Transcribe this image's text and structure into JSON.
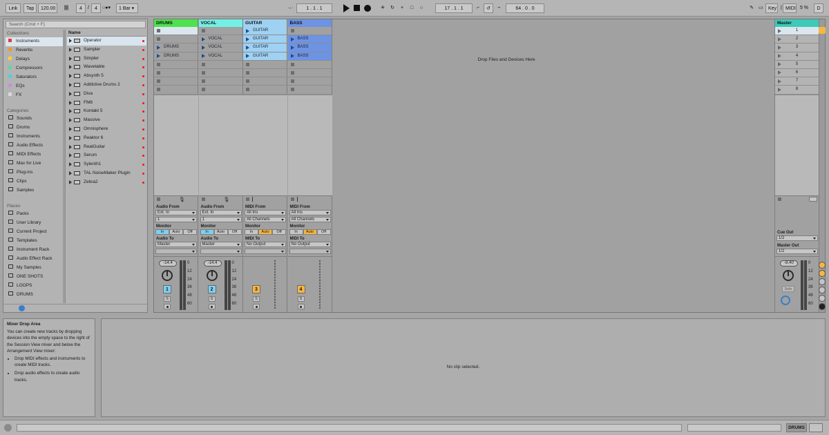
{
  "transport": {
    "link": "Link",
    "tap": "Tap",
    "tempo": "120.00",
    "signature_num": "4",
    "signature_den": "4",
    "quantize": "1 Bar",
    "position": [
      "1",
      "1",
      "1"
    ],
    "loop_start": [
      "17",
      "1",
      "1"
    ],
    "loop_length": [
      "64",
      "0",
      "0"
    ],
    "key": "Key",
    "midi": "MIDI",
    "cpu": "5 %",
    "disk": "D"
  },
  "browser": {
    "search_placeholder": "Search (Cmd + F)",
    "collections_header": "Collections",
    "collections": [
      {
        "label": "Instruments",
        "color": "#e23b3b"
      },
      {
        "label": "Reverbs",
        "color": "#f19a2a"
      },
      {
        "label": "Delays",
        "color": "#f3d23a"
      },
      {
        "label": "Compressors",
        "color": "#5fd6a0"
      },
      {
        "label": "Saturators",
        "color": "#4bd0e0"
      },
      {
        "label": "EQs",
        "color": "#c58ee0"
      },
      {
        "label": "FX",
        "color": "#d9d9d9"
      }
    ],
    "categories_header": "Categories",
    "categories": [
      "Sounds",
      "Drums",
      "Instruments",
      "Audio Effects",
      "MIDI Effects",
      "Max for Live",
      "Plug-ins",
      "Clips",
      "Samples"
    ],
    "places_header": "Places",
    "places": [
      "Packs",
      "User Library",
      "Current Project",
      "Templates",
      "Instrument Rack",
      "Audio Effect Rack",
      "My Samples",
      "ONE SHOTS",
      "LOOPS",
      "DRUMS"
    ],
    "list_header": "Name",
    "list": [
      "Operator",
      "Sampler",
      "Simpler",
      "Wavetable",
      "Absynth 5",
      "Addictive Drums 2",
      "Diva",
      "FM8",
      "Kontakt 5",
      "Massive",
      "Omnisphere",
      "Reaktor 6",
      "RealGuitar",
      "Serum",
      "Sylenth1",
      "TAL NoiseMaker Plugin",
      "Zebra2"
    ]
  },
  "tracks": [
    {
      "name": "DRUMS",
      "color": "#4ee24e",
      "clip_color": "#b7b7b7",
      "slots": [
        "",
        "",
        "DRUMS",
        "DRUMS",
        "",
        "",
        "",
        ""
      ],
      "io_from_label": "Audio From",
      "io_from": "Ext. In",
      "io_channel": "1",
      "monitor_label": "Monitor",
      "monitor": [
        "In",
        "Auto",
        "Off"
      ],
      "monitor_active": "In",
      "io_to_label": "Audio To",
      "io_to": "Master",
      "volume": "-14.4",
      "number": "1",
      "number_color": "#7fd0f0",
      "solo": "S"
    },
    {
      "name": "VOCAL",
      "color": "#74efe6",
      "clip_color": "#b7b7b7",
      "slots": [
        "",
        "VOCAL",
        "VOCAL",
        "VOCAL",
        "",
        "",
        "",
        ""
      ],
      "io_from_label": "Audio From",
      "io_from": "Ext. In",
      "io_channel": "1",
      "monitor_label": "Monitor",
      "monitor": [
        "In",
        "Auto",
        "Off"
      ],
      "monitor_active": "In",
      "io_to_label": "Audio To",
      "io_to": "Master",
      "volume": "-14.4",
      "number": "2",
      "number_color": "#7fd0f0",
      "solo": "S"
    },
    {
      "name": "GUITAR",
      "color": "#9fd1f2",
      "clip_color": "#9fd1f2",
      "slots": [
        "GUITAR",
        "GUITAR",
        "GUITAR",
        "GUITAR",
        "",
        "",
        "",
        ""
      ],
      "io_from_label": "MIDI From",
      "io_from": "All Ins",
      "io_channel": "All Channels",
      "monitor_label": "Monitor",
      "monitor": [
        "In",
        "Auto",
        "Off"
      ],
      "monitor_active": "Auto",
      "io_to_label": "MIDI To",
      "io_to": "No Output",
      "volume": "",
      "number": "3",
      "number_color": "#f5b642",
      "solo": "S"
    },
    {
      "name": "BASS",
      "color": "#6d93e4",
      "clip_color": "#6d93e4",
      "slots": [
        "",
        "BASS",
        "BASS",
        "BASS",
        "",
        "",
        "",
        ""
      ],
      "io_from_label": "MIDI From",
      "io_from": "All Ins",
      "io_channel": "All Channels",
      "monitor_label": "Monitor",
      "monitor": [
        "In",
        "Auto",
        "Off"
      ],
      "monitor_active": "Auto",
      "io_to_label": "MIDI To",
      "io_to": "No Output",
      "volume": "",
      "number": "4",
      "number_color": "#f5b642",
      "solo": "S"
    }
  ],
  "meter_scale": [
    "0",
    "12",
    "24",
    "36",
    "48",
    "60"
  ],
  "drop_hint": "Drop Files and Devices Here",
  "master": {
    "name": "Master",
    "color": "#3ec9b8",
    "scenes": [
      "1",
      "2",
      "3",
      "4",
      "5",
      "6",
      "7",
      "8"
    ],
    "cue_out_label": "Cue Out",
    "cue_out": "1/2",
    "master_out_label": "Master Out",
    "master_out": "1/2",
    "volume": "-8.40",
    "solo": "Solo"
  },
  "info": {
    "title": "Mixer Drop Area",
    "body": "You can create new tracks by dropping devices into the empty space to the right of the Session View mixer and below the Arrangement View mixer:",
    "bullets": [
      "Drop MIDI effects and instruments to create MIDI tracks.",
      "Drop audio effects to create audio tracks."
    ]
  },
  "detail": {
    "message": "No clip selected."
  },
  "status": {
    "selected_track": "DRUMS"
  }
}
